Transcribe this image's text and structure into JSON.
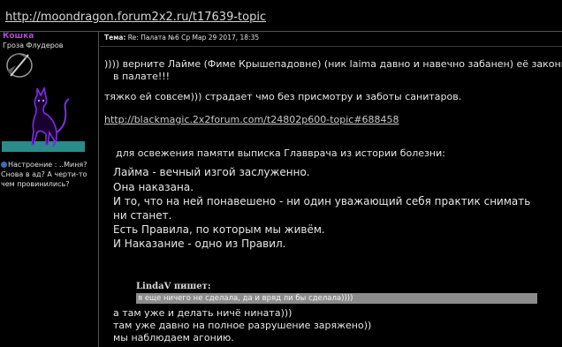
{
  "topic_url": "http://moondragon.forum2x2.ru/t17639-topic",
  "author": {
    "name": "Кошка",
    "rank": "Гроза Флудеров",
    "mood": "Настроение : ..Миня? Снова в ад? А черти-то чем провинились?"
  },
  "post": {
    "header_label": "Тема:",
    "header_value": "Re: Палата №6   Ср Мар 29 2017, 18:35",
    "lines": [
      "))))  верните Лайме (Фиме Крышепадовне)   (ник laima давно  и навечно забанен) её законное",
      "в палате!!!",
      "тяжко ей  совсем)))  страдает чмо без  присмотру  и заботы санитаров."
    ],
    "link": "http://blackmagic.2x2forum.com/t24802p600-topic#688458",
    "extract_intro": "для  освежения  памяти  выписка Главврача из истории болезни:",
    "extract_lines": [
      "Лайма - вечный  изгой  заслуженно.",
      "Она  наказана.",
      "И то, что  на  ней  понавешено -  ни  один  уважающий  себя практик  снимать",
      "ни станет.",
      "Есть Правила, по  которым мы живём.",
      "И Наказание  -  одно  из Правил."
    ],
    "quote_author": "LindaV пишет:",
    "quote_text": "я еще ничего не сделала, да и вряд ли бы сделала))))",
    "after_lines": [
      "а  там  уже  и делать ничё  нината)))",
      " там  уже  давно на  полное  разрушение  заряжено))",
      "мы  наблюдаем агонию."
    ]
  }
}
